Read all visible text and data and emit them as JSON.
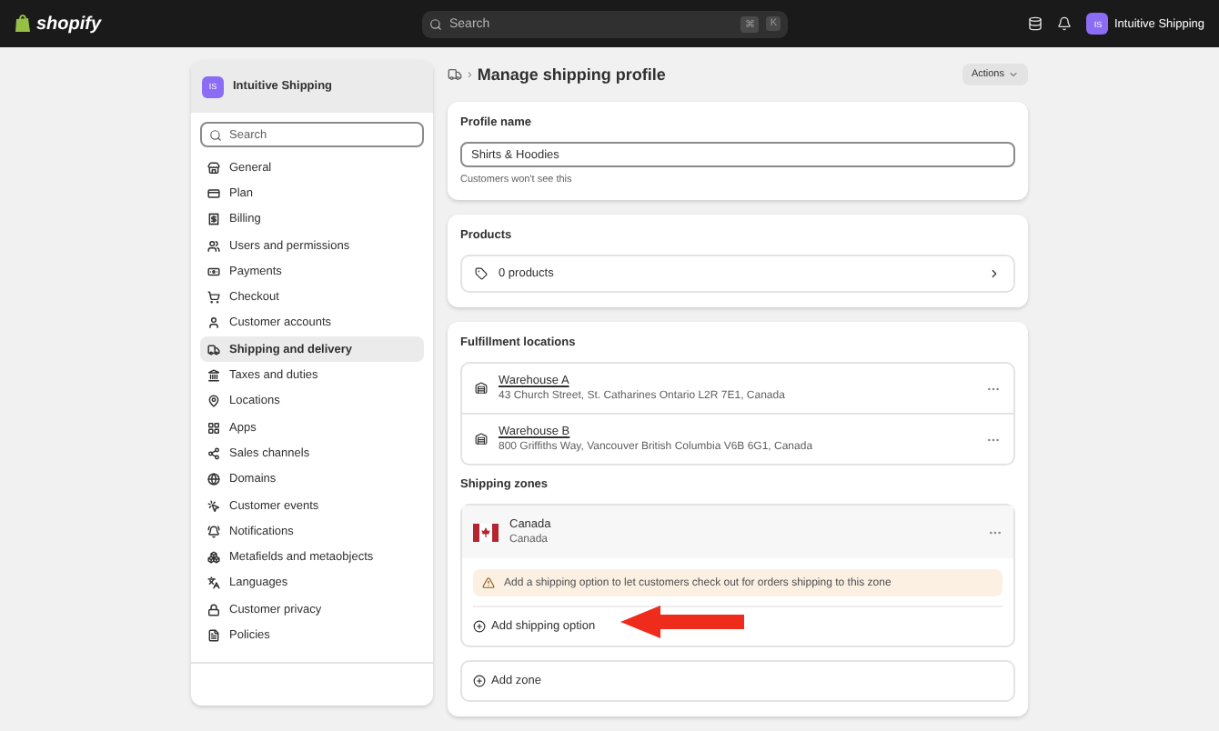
{
  "topbar": {
    "logo": "shopify",
    "search": {
      "placeholder": "Search",
      "keys": [
        "⌘",
        "K"
      ]
    },
    "store": {
      "initials": "IS",
      "name": "Intuitive Shipping"
    }
  },
  "sidebar": {
    "store": {
      "initials": "IS",
      "name": "Intuitive Shipping"
    },
    "search": {
      "placeholder": "Search"
    },
    "items": [
      {
        "label": "General",
        "selected": false
      },
      {
        "label": "Plan",
        "selected": false
      },
      {
        "label": "Billing",
        "selected": false
      },
      {
        "label": "Users and permissions",
        "selected": false
      },
      {
        "label": "Payments",
        "selected": false
      },
      {
        "label": "Checkout",
        "selected": false
      },
      {
        "label": "Customer accounts",
        "selected": false
      },
      {
        "label": "Shipping and delivery",
        "selected": true
      },
      {
        "label": "Taxes and duties",
        "selected": false
      },
      {
        "label": "Locations",
        "selected": false
      },
      {
        "label": "Apps",
        "selected": false
      },
      {
        "label": "Sales channels",
        "selected": false
      },
      {
        "label": "Domains",
        "selected": false
      },
      {
        "label": "Customer events",
        "selected": false
      },
      {
        "label": "Notifications",
        "selected": false
      },
      {
        "label": "Metafields and metaobjects",
        "selected": false
      },
      {
        "label": "Languages",
        "selected": false
      },
      {
        "label": "Customer privacy",
        "selected": false
      },
      {
        "label": "Policies",
        "selected": false
      }
    ]
  },
  "page": {
    "separator": "›",
    "title": "Manage shipping profile",
    "actions": "Actions"
  },
  "profile": {
    "heading": "Profile name",
    "value": "Shirts & Hoodies",
    "help": "Customers won't see this"
  },
  "products": {
    "heading": "Products",
    "count": "0 products"
  },
  "fulfillment": {
    "heading": "Fulfillment locations",
    "locations": [
      {
        "name": "Warehouse A",
        "address": "43 Church Street, St. Catharines Ontario L2R 7E1, Canada"
      },
      {
        "name": "Warehouse B",
        "address": "800 Griffiths Way, Vancouver British Columbia V6B 6G1, Canada"
      }
    ]
  },
  "zones": {
    "heading": "Shipping zones",
    "items": [
      {
        "name": "Canada",
        "countries": "Canada",
        "warning": "Add a shipping option to let customers check out for orders shipping to this zone",
        "add_option": "Add shipping option"
      }
    ],
    "add_zone": "Add zone"
  }
}
